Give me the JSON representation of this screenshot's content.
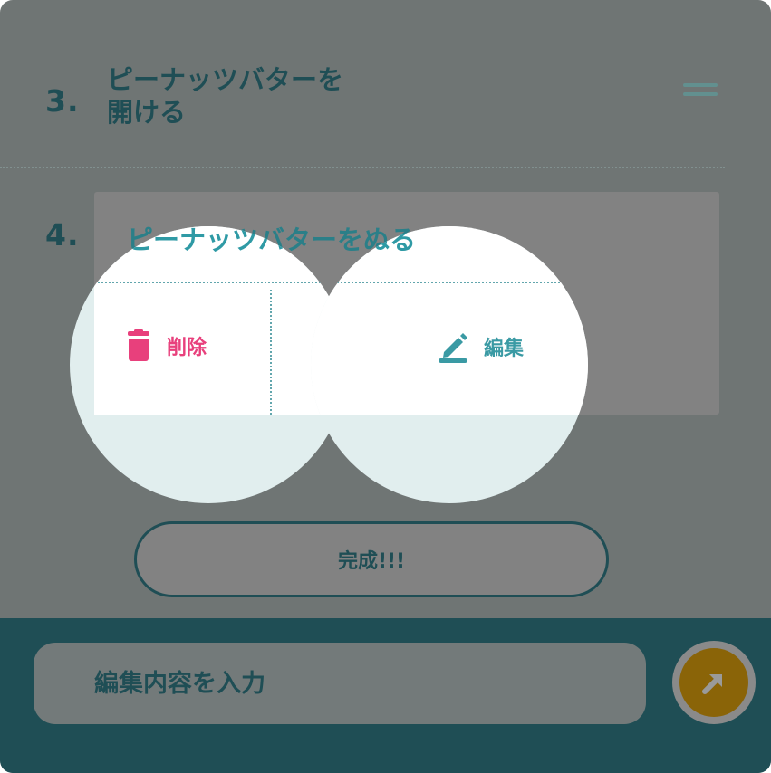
{
  "steps": [
    {
      "number": "3.",
      "text": "ピーナッツバターを\n開ける"
    },
    {
      "number": "4.",
      "text": "ピーナッツバターをぬる"
    }
  ],
  "actions": {
    "delete_label": "削除",
    "edit_label": "編集"
  },
  "complete_button": {
    "label": "完成!!!"
  },
  "bottom_bar": {
    "input_placeholder": "編集内容を入力"
  },
  "icons": {
    "delete": "trash-icon",
    "edit": "pencil-icon",
    "send": "arrow-up-right-icon",
    "drag": "drag-handle-icon"
  },
  "colors": {
    "primary": "#1f4e55",
    "accent_teal": "#2f9aa5",
    "delete_pink": "#e8407c",
    "send_gold": "#8a6408"
  }
}
